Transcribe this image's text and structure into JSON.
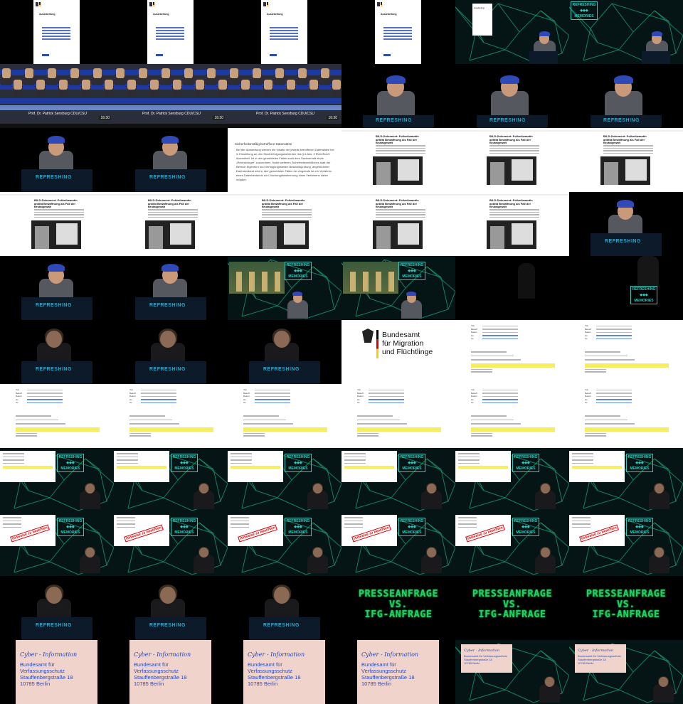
{
  "grid": {
    "columns": 6,
    "rows": 11
  },
  "doc_title": "Ausarbeitung",
  "hall_banner": "Prof. Dr. Patrick Sensburg CDU/CSU",
  "hall_left_ticker": "Zeitansage 16:20 Uhr",
  "hall_right_ticker": "Abstimmungen zu ZP 1 2",
  "hall_time": "16:30",
  "podium_text": "REFRESHING",
  "slide_heading": "Sicherheitsmäßig betroffene Datensätze",
  "slide_body": "Bei der Auswertung werden die Inhalte der jeweils betroffenen Datensätze bei in Einstellung an den Strafverfolgungsbehörden des § 6 Abs. 2 BVerfSchG übermittelt. Ist in den gemeldeten Fällen auch dem Sachverhalt eines „Reichsbürger“ zuzuordnen, findet weiteren Sicherheitsrechtliches statt der Bereich Eigenturn und Verfolgungsstellen Bestandsprüfung, angeforderter Datenbestand wird in den gemeldeten Fällen der Angebote ist ein Verfahren eines Datenbestands zur Löschungsbestimmung eines Verfahrens daher möglich.",
  "news_title": "BILD-Dokument: Polizeibeamtin antifat Bewaffnung als Fall der Brutalgewalt",
  "bamf_lines": [
    "Bundesamt",
    "für Migration",
    "und Flüchtlinge"
  ],
  "email_fields": {
    "von": "Von",
    "betreff": "Betreff",
    "datum": "Datum",
    "an": "An",
    "cc": "Cc"
  },
  "stamp_text": "Hinweise zu beachten",
  "presse_lines": [
    "PRESSEANFRAGE",
    "VS.",
    "IFG-ANFRAGE"
  ],
  "handwritten": "Cyber - Information",
  "stamped_lines": [
    "Bundesamt für Verfassungsschutz",
    "Stauffenbergstraße 18",
    "10785 Berlin"
  ],
  "colors": {
    "accent_green": "#1fd160",
    "conference_bg": "#051515",
    "bamf_text": "#111111",
    "cap_blue": "#2f49b8"
  },
  "cells": [
    "doc",
    "doc",
    "doc",
    "doc",
    "conf-doc",
    "conf-speaker",
    "hall",
    "hall",
    "hall",
    "stage-cap-wide",
    "stage-cap-wide",
    "stage-cap-wide",
    "stage-cap",
    "stage-cap",
    "slide-text",
    "news",
    "news",
    "news",
    "news",
    "news",
    "news",
    "news",
    "news",
    "stage-cap",
    "stage-cap",
    "stage-cap",
    "conf-outdoor",
    "conf-outdoor",
    "stage-dark",
    "conf-dark",
    "stage-woman",
    "stage-woman",
    "stage-woman",
    "bamf",
    "email",
    "email",
    "email",
    "email",
    "email",
    "email",
    "email",
    "email",
    "conf-email",
    "conf-email",
    "conf-email",
    "conf-email",
    "conf-email",
    "conf-email",
    "conf-stamp",
    "conf-stamp",
    "conf-stamp",
    "conf-stamp",
    "conf-stamp",
    "conf-stamp",
    "stage-woman",
    "stage-woman",
    "stage-woman",
    "presse",
    "presse",
    "presse",
    "paper",
    "paper",
    "paper",
    "paper",
    "conf-paper",
    "conf-paper"
  ]
}
